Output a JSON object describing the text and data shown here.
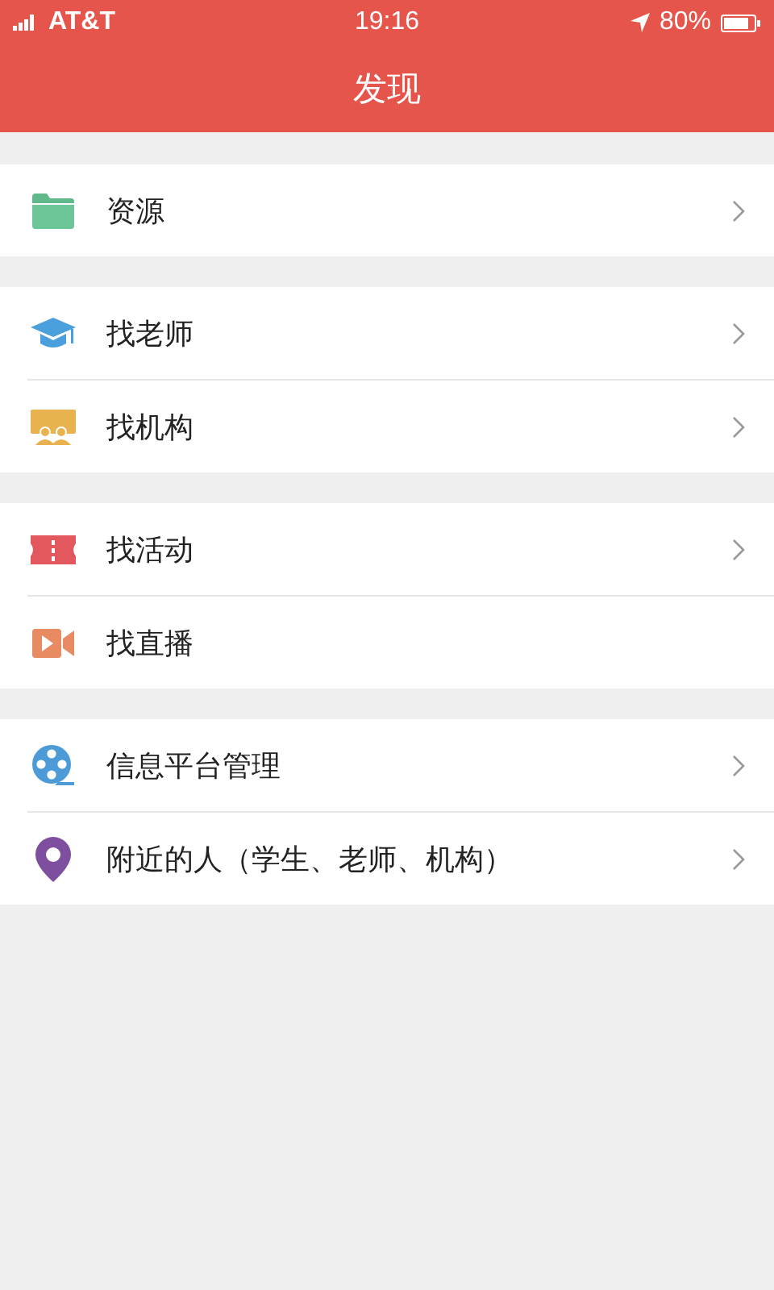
{
  "status_bar": {
    "carrier": "AT&T",
    "time": "19:16",
    "battery": "80%"
  },
  "header": {
    "title": "发现"
  },
  "groups": [
    {
      "items": [
        {
          "kind": "folder",
          "label": "资源",
          "arrow": true
        }
      ]
    },
    {
      "items": [
        {
          "kind": "cap",
          "label": "找老师",
          "arrow": true
        },
        {
          "kind": "screen",
          "label": "找机构",
          "arrow": true
        }
      ]
    },
    {
      "items": [
        {
          "kind": "ticket",
          "label": "找活动",
          "arrow": true
        },
        {
          "kind": "video",
          "label": "找直播",
          "arrow": false
        }
      ]
    },
    {
      "items": [
        {
          "kind": "reel",
          "label": "信息平台管理",
          "arrow": true
        },
        {
          "kind": "pin",
          "label": "附近的人（学生、老师、机构）",
          "arrow": true
        }
      ]
    }
  ]
}
